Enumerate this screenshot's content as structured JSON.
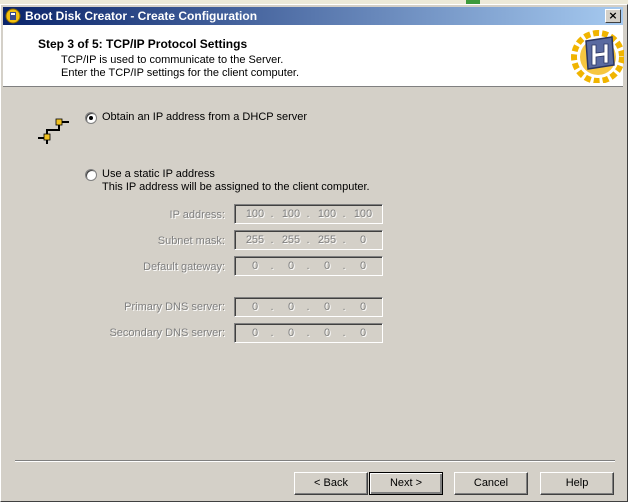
{
  "window": {
    "title": "Boot Disk Creator - Create Configuration",
    "close_label": "×"
  },
  "header": {
    "step_title": "Step 3 of 5: TCP/IP Protocol Settings",
    "line1": "TCP/IP is used to communicate to the Server.",
    "line2": "Enter the TCP/IP settings for the client computer."
  },
  "options": {
    "dhcp_label": "Obtain an IP address from a DHCP server",
    "dhcp_selected": true,
    "static_label": "Use a static IP address",
    "static_sub": "This IP address will be assigned to the client computer."
  },
  "fields": {
    "ip_label": "IP address:",
    "ip": [
      "100",
      "100",
      "100",
      "100"
    ],
    "subnet_label": "Subnet mask:",
    "subnet": [
      "255",
      "255",
      "255",
      "0"
    ],
    "gateway_label": "Default gateway:",
    "gateway": [
      "0",
      "0",
      "0",
      "0"
    ],
    "dns1_label": "Primary DNS server:",
    "dns1": [
      "0",
      "0",
      "0",
      "0"
    ],
    "dns2_label": "Secondary DNS server:",
    "dns2": [
      "0",
      "0",
      "0",
      "0"
    ],
    "dot": "."
  },
  "buttons": {
    "back": "< Back",
    "next": "Next >",
    "cancel": "Cancel",
    "help": "Help"
  },
  "colors": {
    "titlebar_start": "#0a246a",
    "titlebar_end": "#a6caf0",
    "dialog_face": "#d4d0c8",
    "disabled_text": "#808080"
  }
}
